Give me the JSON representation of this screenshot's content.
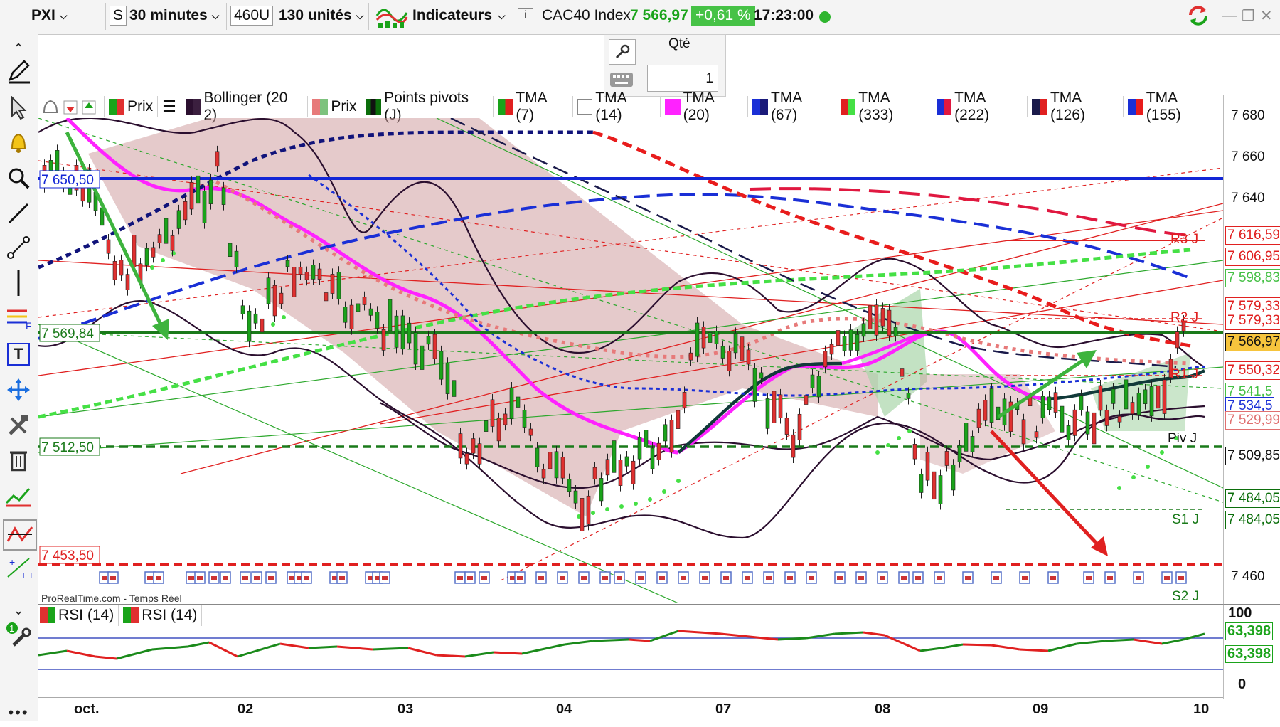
{
  "toolbar": {
    "symbol": "PXI",
    "s_label": "S",
    "timeframe": "30 minutes",
    "units_box": "460U",
    "units": "130 unités",
    "indicators": "Indicateurs",
    "instrument": "CAC40 Index",
    "price": "7 566,97",
    "change": "+0,61 %",
    "time": "17:23:00"
  },
  "order": {
    "qty_label": "Qté",
    "qty_value": "1"
  },
  "legend": [
    {
      "label": "Prix",
      "color": "#1aa31a"
    },
    {
      "label": "Bollinger (20 2)",
      "color": "#2b0f2f"
    },
    {
      "label": "Prix",
      "color": "#e77a7a"
    },
    {
      "label": "Points pivots (J)",
      "color": "#0b6e0b"
    },
    {
      "label": "TMA (7)",
      "color": "#e02020"
    },
    {
      "label": "TMA (14)",
      "color": "#ffffff"
    },
    {
      "label": "TMA (20)",
      "color": "#ff22ff"
    },
    {
      "label": "TMA (67)",
      "color": "#1a2fd6"
    },
    {
      "label": "TMA (333)",
      "color": "#45e045"
    },
    {
      "label": "TMA (222)",
      "color": "#e01840"
    },
    {
      "label": "TMA (126)",
      "color": "#1a1a4a"
    },
    {
      "label": "TMA (155)",
      "color": "#e81c1c"
    }
  ],
  "yaxis": {
    "ticks": [
      "7 680",
      "7 660",
      "7 640",
      "7 460"
    ],
    "tags": [
      {
        "text": "7 616,59",
        "color": "#e02020",
        "bg": "#ffffff"
      },
      {
        "text": "7 606,95",
        "color": "#e02020",
        "bg": "#ffffff"
      },
      {
        "text": "7 598,83",
        "color": "#45c045",
        "bg": "#ffffff"
      },
      {
        "text": "7 579,33",
        "color": "#e02020",
        "bg": "#ffffff"
      },
      {
        "text": "7 579,33",
        "color": "#e02020",
        "bg": "#ffffff"
      },
      {
        "text": "7 566,97",
        "color": "#111111",
        "bg": "#f6c43d"
      },
      {
        "text": "7 550,32",
        "color": "#e02020",
        "bg": "#ffffff"
      },
      {
        "text": "7 541,5",
        "color": "#45c045",
        "bg": "#ffffff"
      },
      {
        "text": "7 534,5",
        "color": "#1a2fd6",
        "bg": "#ffffff"
      },
      {
        "text": "7 529,99",
        "color": "#e07070",
        "bg": "#ffffff"
      },
      {
        "text": "7 509,85",
        "color": "#111111",
        "bg": "#ffffff"
      },
      {
        "text": "7 484,05",
        "color": "#0b6e0b",
        "bg": "#ffffff"
      },
      {
        "text": "7 484,05",
        "color": "#0b6e0b",
        "bg": "#ffffff"
      }
    ]
  },
  "levels": {
    "blue_line": "7 650,50",
    "green_line": "7 569,84",
    "dashed_green": "7 512,50",
    "dashed_red": "7 453,50"
  },
  "pivots": {
    "r3": "R3 J",
    "r2": "R2 J",
    "r1": "R1 J",
    "piv": "Piv J",
    "s1": "S1 J",
    "s2": "S2 J"
  },
  "watermark": "ProRealTime.com - Temps Réel",
  "rsi": {
    "legend": [
      "RSI (14)",
      "RSI (14)"
    ],
    "ticks": [
      "100",
      "0"
    ],
    "tags": [
      "63,398",
      "63,398"
    ]
  },
  "xaxis": {
    "labels": [
      "oct.",
      "02",
      "03",
      "04",
      "07",
      "08",
      "09",
      "10"
    ]
  },
  "colors": {
    "up": "#1aa31a",
    "down": "#e03030",
    "accent_green": "#1aa31a"
  }
}
